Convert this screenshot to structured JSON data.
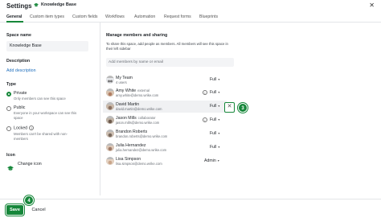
{
  "header": {
    "title": "Settings",
    "space_name": "Knowledge Base",
    "close_icon": "close-icon"
  },
  "tabs": [
    {
      "label": "General",
      "active": true
    },
    {
      "label": "Custom item types"
    },
    {
      "label": "Custom fields"
    },
    {
      "label": "Workflows"
    },
    {
      "label": "Automation"
    },
    {
      "label": "Request forms"
    },
    {
      "label": "Blueprints"
    }
  ],
  "left": {
    "space_name_label": "Space name",
    "space_name_value": "Knowledge Base",
    "description_label": "Description",
    "add_description": "Add description",
    "type_label": "Type",
    "types": [
      {
        "label": "Private",
        "sub": "Only members can see this space",
        "selected": true
      },
      {
        "label": "Public",
        "sub1": "Everyone in your workspace can see this",
        "sub2": "space"
      },
      {
        "label": "Locked",
        "sub1": "Members can't be shared with non-",
        "sub2": "members"
      }
    ],
    "icon_label": "Icon",
    "change_icon": "Change icon"
  },
  "right": {
    "section_title": "Manage members and sharing",
    "description": "To share this space, add people as members. All members will see this space in their left sidebar",
    "add_placeholder": "Add members by name or email",
    "members": [
      {
        "name": "My Team",
        "role": "",
        "sub": "4 users",
        "permission": "Full",
        "avatar_color": "#9aa0a6",
        "info": false
      },
      {
        "name": "Amy White",
        "role": "external",
        "sub": "amy.white@demo.wrike.com",
        "permission": "Full",
        "avatar_color": "#b07d62",
        "info": true
      },
      {
        "name": "David Martin",
        "role": "",
        "sub": "david.martin@demo.wrike.com",
        "permission": "Full",
        "avatar_color": "#6b5f56",
        "info": false,
        "highlight": true
      },
      {
        "name": "Jason Mills",
        "role": "collaborator",
        "sub": "jason.mills@demo.wrike.com",
        "permission": "Full",
        "avatar_color": "#5a5048",
        "info": true
      },
      {
        "name": "Brandon Roberts",
        "role": "",
        "sub": "brandon.roberts@demo.wrike.com",
        "permission": "Full",
        "avatar_color": "#7a6a5e",
        "info": false
      },
      {
        "name": "Julia Hernandez",
        "role": "",
        "sub": "julia.hernandez@demo.wrike.com",
        "permission": "Full",
        "avatar_color": "#a07a66",
        "info": false
      },
      {
        "name": "Lisa Simpson",
        "role": "",
        "sub": "lisa.simpson@demo.wrike.com",
        "permission": "Admin",
        "avatar_color": "#c9a58a",
        "info": false
      }
    ]
  },
  "callouts": {
    "remove_step": "3",
    "save_step": "4",
    "remove_symbol": "✕"
  },
  "footer": {
    "save": "Save",
    "cancel": "Cancel"
  },
  "colors": {
    "accent": "#16873a",
    "link": "#1f6fbd"
  }
}
